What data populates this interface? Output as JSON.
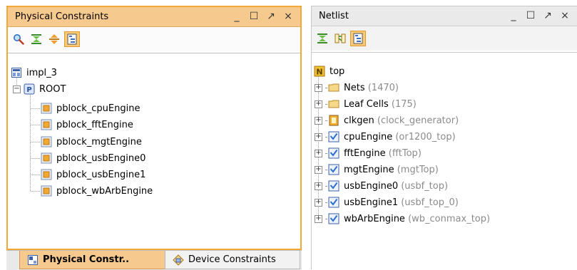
{
  "physical_panel": {
    "title": "Physical Constraints",
    "window_buttons": {
      "minimize": "_",
      "maximize": "☐",
      "float": "↗",
      "close": "×"
    },
    "toolbar": [
      "search-icon",
      "collapse-all-icon",
      "expand-all-icon",
      "show-hierarchy-icon"
    ],
    "tree": {
      "root_label": "impl_3",
      "node_label": "ROOT",
      "pblocks": [
        "pblock_cpuEngine",
        "pblock_fftEngine",
        "pblock_mgtEngine",
        "pblock_usbEngine0",
        "pblock_usbEngine1",
        "pblock_wbArbEngine"
      ]
    }
  },
  "bottom_tabs": [
    {
      "label": "Physical Constr..",
      "active": true
    },
    {
      "label": "Device Constraints",
      "active": false
    }
  ],
  "netlist_panel": {
    "title": "Netlist",
    "window_buttons": {
      "minimize": "_",
      "maximize": "☐",
      "float": "↗",
      "close": "×"
    },
    "toolbar": [
      "collapse-all-icon",
      "show-connectivity-icon",
      "show-hierarchy-icon"
    ],
    "top_label": "top",
    "items": [
      {
        "name": "Nets",
        "detail": "(1470)",
        "kind": "folder"
      },
      {
        "name": "Leaf Cells",
        "detail": "(175)",
        "kind": "folder"
      },
      {
        "name": "clkgen",
        "detail": "(clock_generator)",
        "kind": "clock"
      },
      {
        "name": "cpuEngine",
        "detail": "(or1200_top)",
        "kind": "module"
      },
      {
        "name": "fftEngine",
        "detail": "(fftTop)",
        "kind": "module"
      },
      {
        "name": "mgtEngine",
        "detail": "(mgtTop)",
        "kind": "module"
      },
      {
        "name": "usbEngine0",
        "detail": "(usbf_top)",
        "kind": "module"
      },
      {
        "name": "usbEngine1",
        "detail": "(usbf_top_0)",
        "kind": "module"
      },
      {
        "name": "wbArbEngine",
        "detail": "(wb_conmax_top)",
        "kind": "module"
      }
    ]
  },
  "colors": {
    "active_border": "#f4a83a",
    "active_header": "#f6c98e",
    "detail_text": "#8b8b8b"
  }
}
